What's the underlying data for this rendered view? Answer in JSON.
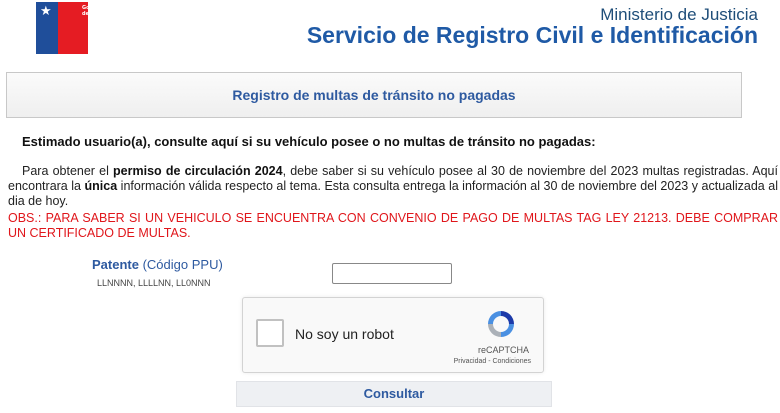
{
  "header": {
    "logo_text": "Gobierno de Chile",
    "ministerio": "Ministerio de Justicia",
    "servicio": "Servicio de Registro Civil e Identificación"
  },
  "title": "Registro de multas de tránsito no pagadas",
  "intro": "Estimado usuario(a), consulte aquí si su vehículo posee o no multas de tránsito no pagadas:",
  "paragraph": {
    "part1": "Para obtener el ",
    "bold1": "permiso de circulación 2024",
    "part2": ", debe saber si su vehículo posee al 30 de noviembre del 2023    multas registradas. Aquí encontrara la ",
    "bold2": "única",
    "part3": " información válida respecto al tema. Esta consulta entrega la    información al 30 de noviembre del 2023 y actualizada al dia de hoy."
  },
  "obs": "OBS.: PARA SABER SI UN VEHICULO SE ENCUENTRA CON CONVENIO DE PAGO DE MULTAS TAG LEY 21213.           DEBE COMPRAR UN CERTIFICADO DE MULTAS.",
  "form": {
    "patente_label": "Patente",
    "codigo_label": "(Código PPU)",
    "formats_hint": "LLNNNN, LLLLNN, LL0NNN",
    "patente_value": ""
  },
  "captcha": {
    "label": "No soy un robot",
    "brand": "reCAPTCHA",
    "terms": "Privacidad - Condiciones"
  },
  "submit_label": "Consultar",
  "colors": {
    "brand_blue": "#1f5aa6",
    "link_blue": "#2e5aa0",
    "warning_red": "#e0161b",
    "flag_red": "#e51c23"
  }
}
